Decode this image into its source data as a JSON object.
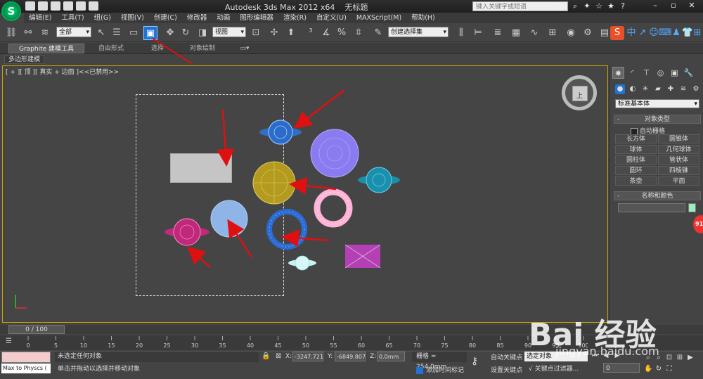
{
  "app": {
    "title": "Autodesk 3ds Max  2012 x64",
    "file": "无标题",
    "logo": "S"
  },
  "search": {
    "placeholder": "键入关键字或短语"
  },
  "menu": [
    "编辑(E)",
    "工具(T)",
    "组(G)",
    "视图(V)",
    "创建(C)",
    "修改器",
    "动画",
    "图形编辑器",
    "渲染(R)",
    "自定义(U)",
    "MAXScript(M)",
    "帮助(H)"
  ],
  "toolbar": {
    "filter": "全部",
    "coord_system": "视图",
    "named_sel": "创建选择集"
  },
  "ribbon": {
    "tabs": [
      "Graphite 建模工具",
      "自由形式",
      "选择",
      "对象绘制"
    ],
    "subtab": "多边形建模"
  },
  "viewport": {
    "label": "[ + ][ 顶 ][ 真实 + 边面 ]<<已禁用>>",
    "viewcube_label": "上"
  },
  "command_panel": {
    "category": "标准基本体",
    "rollout_object_type": "对象类型",
    "autogrid": "自动栅格",
    "buttons": [
      "长方体",
      "圆锥体",
      "球体",
      "几何球体",
      "圆柱体",
      "管状体",
      "圆环",
      "四棱锥",
      "茶壶",
      "平面"
    ],
    "rollout_name_color": "名称和颜色",
    "name_color": "#9eebc0"
  },
  "timeline": {
    "slider": "0 / 100",
    "ticks": [
      "0",
      "5",
      "10",
      "15",
      "20",
      "25",
      "30",
      "35",
      "40",
      "45",
      "50",
      "55",
      "60",
      "65",
      "70",
      "75",
      "80",
      "85",
      "90",
      "95",
      "100"
    ]
  },
  "status": {
    "maxscript": "Max to Physcs (",
    "selection": "未选定任何对象",
    "prompt": "单击并拖动以选择并移动对象",
    "x": "-3247.721",
    "y": "-6849.807",
    "z": "0.0mm",
    "grid": "栅格 = 254.0mm",
    "add_time_tag": "添加时间标记",
    "auto_key": "自动关键点",
    "set_key": "设置关键点",
    "selected": "选定对象",
    "key_filters": "关键点过滤器...",
    "frame": "0"
  },
  "side_badge": "91",
  "watermark": {
    "text": "Bai 经验",
    "url": "jingyan.baidu.com"
  }
}
